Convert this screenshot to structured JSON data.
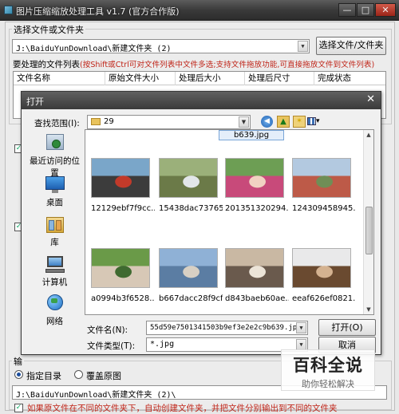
{
  "app": {
    "title": "图片压缩缩放处理工具 v1.7 (官方合作版)",
    "min_glyph": "—",
    "max_glyph": "□",
    "close_glyph": "✕"
  },
  "source": {
    "group_label": "选择文件或文件夹",
    "path": "J:\\BaiduYunDownload\\新建文件夹 (2)",
    "select_button": "选择文件/文件夹",
    "list_label": "要处理的文件列表",
    "list_hint": "(按Shift或Ctrl可对文件列表中文件多选;支持文件拖放功能,可直接拖放文件到文件列表)",
    "columns": [
      "文件名称",
      "原始文件大小",
      "处理后大小",
      "处理后尺寸",
      "完成状态"
    ]
  },
  "output": {
    "group_label": "输",
    "radio_target": "指定目录",
    "radio_overwrite": "覆盖原图",
    "path": "J:\\BaiduYunDownload\\新建文件夹 (2)\\",
    "checkbox_label": "如果原文件在不同的文件夹下，自动创建文件夹，并把文件分别输出到不同的文件夹"
  },
  "dialog": {
    "title": "打开",
    "close_glyph": "✕",
    "lookin_label": "查找范围(I):",
    "lookin_value": "29",
    "places": [
      {
        "label": "最近访问的位置",
        "icon": "recent-places-icon"
      },
      {
        "label": "桌面",
        "icon": "desktop-icon"
      },
      {
        "label": "库",
        "icon": "libraries-icon"
      },
      {
        "label": "计算机",
        "icon": "computer-icon"
      },
      {
        "label": "网络",
        "icon": "network-icon"
      }
    ],
    "partial_file": "b639.jpg",
    "files": [
      {
        "name": "12129ebf7f9cc...",
        "colors": [
          "#7aa6c9",
          "#3c3c3c",
          "#c23a2a"
        ]
      },
      {
        "name": "15438dac73765...",
        "colors": [
          "#9bb07a",
          "#6b7a48",
          "#e2e6e9"
        ]
      },
      {
        "name": "201351320294...",
        "colors": [
          "#6d9e54",
          "#c84a7a",
          "#f1d2c2"
        ]
      },
      {
        "name": "124309458945...",
        "colors": [
          "#b3c9e0",
          "#bd5a48",
          "#6f8e56"
        ]
      },
      {
        "name": "a0994b3f6528...",
        "colors": [
          "#6a9a48",
          "#d7c8b6",
          "#3f6a30"
        ]
      },
      {
        "name": "b667dacc28f9cf...",
        "colors": [
          "#8fb1d6",
          "#5b7da3",
          "#d8d0c4"
        ]
      },
      {
        "name": "d843baeb60ae...",
        "colors": [
          "#c9b8a3",
          "#6a5a4d",
          "#ece4d8"
        ]
      },
      {
        "name": "eeaf626ef0821...",
        "colors": [
          "#e9e9ea",
          "#6a4a30",
          "#d4b290"
        ]
      }
    ],
    "filename_label": "文件名(N):",
    "filename_value": "55d59e7501341503b9ef3e2e2c9b639.jpg",
    "filetype_label": "文件类型(T):",
    "filetype_value": "*.jpg",
    "open_button": "打开(O)",
    "cancel_button": "取消"
  },
  "watermark": {
    "big": "百科全说",
    "small": "助你轻松解决"
  }
}
